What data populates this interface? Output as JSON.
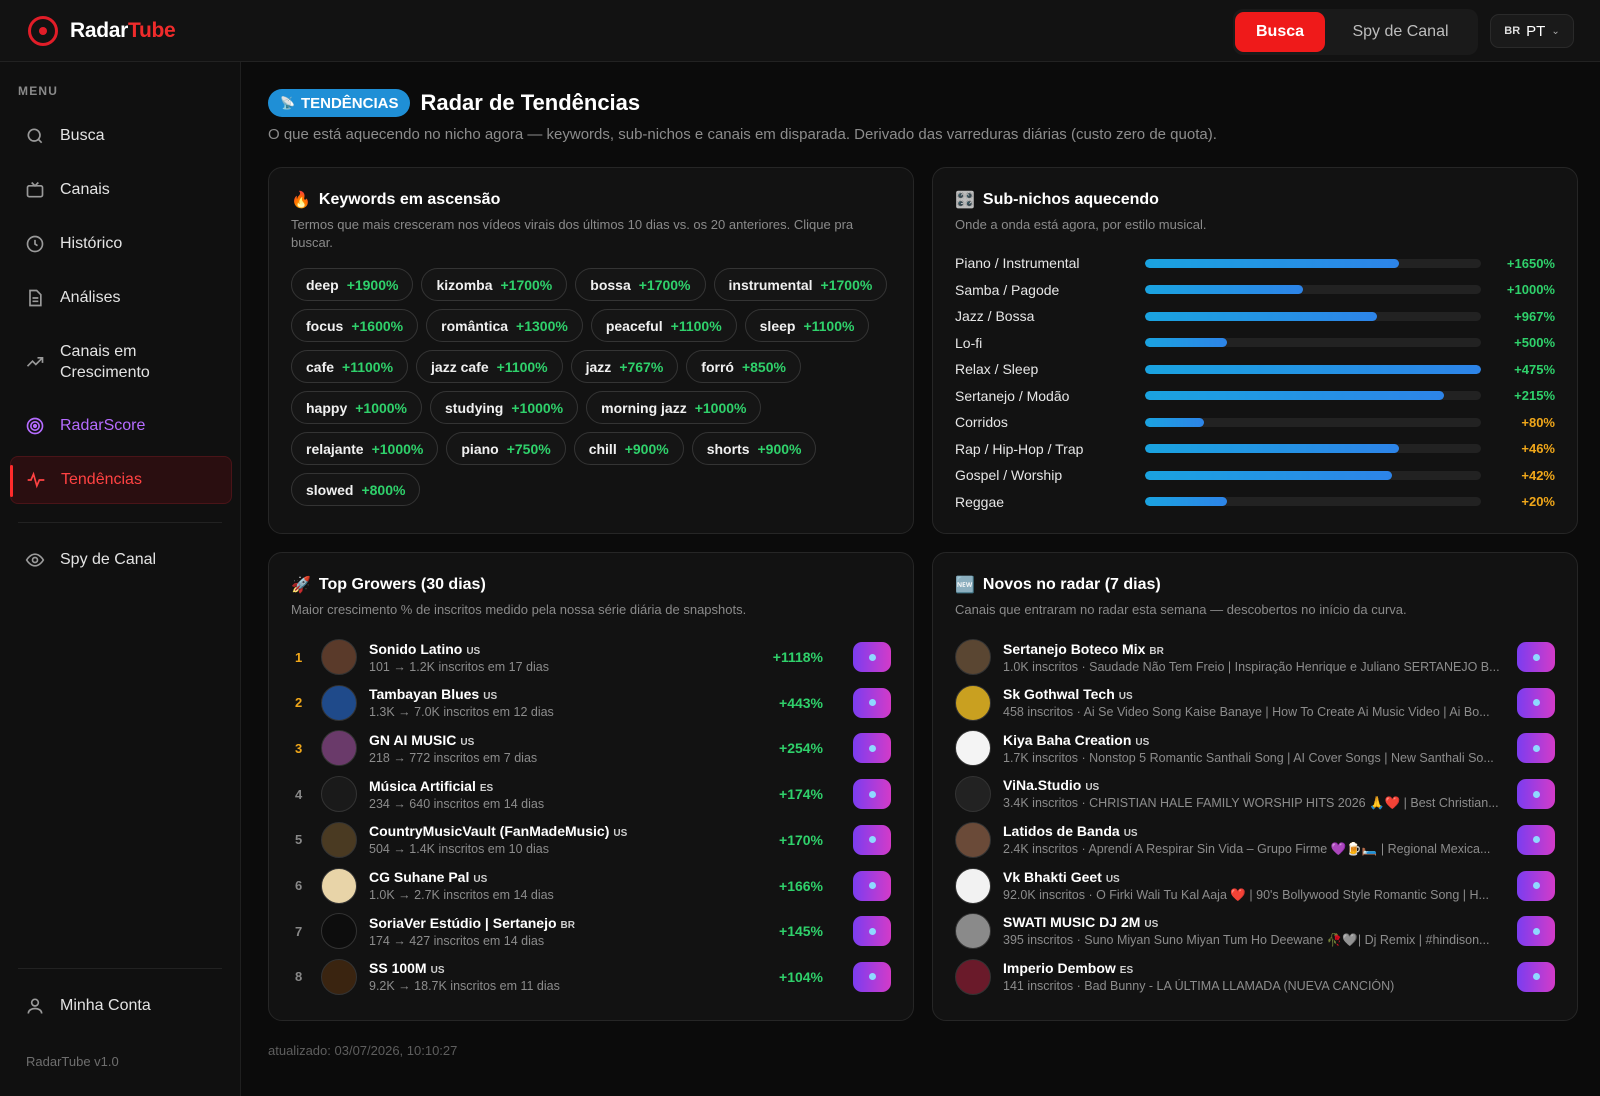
{
  "app": {
    "name_part1": "Radar",
    "name_part2": "Tube",
    "version": "RadarTube v1.0"
  },
  "topbar": {
    "busca": "Busca",
    "spy": "Spy de Canal",
    "lang_flag": "BR",
    "lang": "PT"
  },
  "sidebar": {
    "menu_label": "MENU",
    "items": [
      {
        "label": "Busca",
        "icon": "search-icon"
      },
      {
        "label": "Canais",
        "icon": "tv-icon"
      },
      {
        "label": "Histórico",
        "icon": "clock-icon"
      },
      {
        "label": "Análises",
        "icon": "document-icon"
      },
      {
        "label": "Canais em Crescimento",
        "icon": "trending-icon"
      },
      {
        "label": "RadarScore",
        "icon": "radar-icon"
      },
      {
        "label": "Tendências",
        "icon": "pulse-icon"
      },
      {
        "label": "Spy de Canal",
        "icon": "eye-icon"
      },
      {
        "label": "Minha Conta",
        "icon": "user-icon"
      }
    ]
  },
  "header": {
    "tag": "TENDÊNCIAS",
    "title": "Radar de Tendências",
    "subtitle": "O que está aquecendo no nicho agora — keywords, sub-nichos e canais em disparada. Derivado das varreduras diárias (custo zero de quota)."
  },
  "keywords": {
    "title": "Keywords em ascensão",
    "subtitle": "Termos que mais cresceram nos vídeos virais dos últimos 10 dias vs. os 20 anteriores. Clique pra buscar.",
    "items": [
      {
        "term": "deep",
        "pct": "+1900%"
      },
      {
        "term": "kizomba",
        "pct": "+1700%"
      },
      {
        "term": "bossa",
        "pct": "+1700%"
      },
      {
        "term": "instrumental",
        "pct": "+1700%"
      },
      {
        "term": "focus",
        "pct": "+1600%"
      },
      {
        "term": "romântica",
        "pct": "+1300%"
      },
      {
        "term": "peaceful",
        "pct": "+1100%"
      },
      {
        "term": "sleep",
        "pct": "+1100%"
      },
      {
        "term": "cafe",
        "pct": "+1100%"
      },
      {
        "term": "jazz cafe",
        "pct": "+1100%"
      },
      {
        "term": "jazz",
        "pct": "+767%"
      },
      {
        "term": "forró",
        "pct": "+850%"
      },
      {
        "term": "happy",
        "pct": "+1000%"
      },
      {
        "term": "studying",
        "pct": "+1000%"
      },
      {
        "term": "morning jazz",
        "pct": "+1000%"
      },
      {
        "term": "relajante",
        "pct": "+1000%"
      },
      {
        "term": "piano",
        "pct": "+750%"
      },
      {
        "term": "chill",
        "pct": "+900%"
      },
      {
        "term": "shorts",
        "pct": "+900%"
      },
      {
        "term": "slowed",
        "pct": "+800%"
      }
    ]
  },
  "subniches": {
    "title": "Sub-nichos aquecendo",
    "subtitle": "Onde a onda está agora, por estilo musical.",
    "items": [
      {
        "label": "Piano / Instrumental",
        "pct": "+1650%",
        "level": 0.755,
        "color": "#2fd16b"
      },
      {
        "label": "Samba / Pagode",
        "pct": "+1000%",
        "level": 0.47,
        "color": "#2fd16b"
      },
      {
        "label": "Jazz / Bossa",
        "pct": "+967%",
        "level": 0.69,
        "color": "#2fd16b"
      },
      {
        "label": "Lo-fi",
        "pct": "+500%",
        "level": 0.245,
        "color": "#2fd16b"
      },
      {
        "label": "Relax / Sleep",
        "pct": "+475%",
        "level": 1.0,
        "color": "#2fd16b"
      },
      {
        "label": "Sertanejo / Modão",
        "pct": "+215%",
        "level": 0.89,
        "color": "#2fd16b"
      },
      {
        "label": "Corridos",
        "pct": "+80%",
        "level": 0.175,
        "color": "#f0a71a"
      },
      {
        "label": "Rap / Hip-Hop / Trap",
        "pct": "+46%",
        "level": 0.755,
        "color": "#f0a71a"
      },
      {
        "label": "Gospel / Worship",
        "pct": "+42%",
        "level": 0.735,
        "color": "#f0a71a"
      },
      {
        "label": "Reggae",
        "pct": "+20%",
        "level": 0.245,
        "color": "#f0a71a"
      }
    ]
  },
  "growers": {
    "title": "Top Growers (30 dias)",
    "subtitle": "Maior crescimento % de inscritos medido pela nossa série diária de snapshots.",
    "items": [
      {
        "rank": "1",
        "name": "Sonido Latino",
        "cc": "US",
        "meta": "101 → 1.2K inscritos em 17 dias",
        "growth": "+1118%",
        "avatar_color": "#5a3a2a"
      },
      {
        "rank": "2",
        "name": "Tambayan Blues",
        "cc": "US",
        "meta": "1.3K → 7.0K inscritos em 12 dias",
        "growth": "+443%",
        "avatar_color": "#1f4a8a"
      },
      {
        "rank": "3",
        "name": "GN AI MUSIC",
        "cc": "US",
        "meta": "218 → 772 inscritos em 7 dias",
        "growth": "+254%",
        "avatar_color": "#6a3a6a"
      },
      {
        "rank": "4",
        "name": "Música Artificial",
        "cc": "ES",
        "meta": "234 → 640 inscritos em 14 dias",
        "growth": "+174%",
        "avatar_color": "#1a1a1a"
      },
      {
        "rank": "5",
        "name": "CountryMusicVault (FanMadeMusic)",
        "cc": "US",
        "meta": "504 → 1.4K inscritos em 10 dias",
        "growth": "+170%",
        "avatar_color": "#4a3a22"
      },
      {
        "rank": "6",
        "name": "CG Suhane Pal",
        "cc": "US",
        "meta": "1.0K → 2.7K inscritos em 14 dias",
        "growth": "+166%",
        "avatar_color": "#e8d4a8"
      },
      {
        "rank": "7",
        "name": "SoriaVer Estúdio | Sertanejo",
        "cc": "BR",
        "meta": "174 → 427 inscritos em 14 dias",
        "growth": "+145%",
        "avatar_color": "#0d0d0d"
      },
      {
        "rank": "8",
        "name": "SS 100M",
        "cc": "US",
        "meta": "9.2K → 18.7K inscritos em 11 dias",
        "growth": "+104%",
        "avatar_color": "#3a2410"
      }
    ]
  },
  "novos": {
    "title": "Novos no radar (7 dias)",
    "subtitle": "Canais que entraram no radar esta semana — descobertos no início da curva.",
    "items": [
      {
        "name": "Sertanejo Boteco Mix",
        "cc": "BR",
        "meta": "1.0K inscritos · Saudade Não Tem Freio | Inspiração Henrique e Juliano SERTANEJO B...",
        "avatar_color": "#5a4632"
      },
      {
        "name": "Sk Gothwal Tech",
        "cc": "US",
        "meta": "458 inscritos · Ai Se Video Song Kaise Banaye | How To Create Ai Music Video | Ai Bo...",
        "avatar_color": "#c9a020"
      },
      {
        "name": "Kiya Baha Creation",
        "cc": "US",
        "meta": "1.7K inscritos · Nonstop 5 Romantic Santhali Song | AI Cover Songs | New Santhali So...",
        "avatar_color": "#f4f4f4"
      },
      {
        "name": "ViNa.Studio",
        "cc": "US",
        "meta": "3.4K inscritos · CHRISTIAN HALE FAMILY WORSHIP HITS 2026 🙏❤️ | Best Christian...",
        "avatar_color": "#222222"
      },
      {
        "name": "Latidos de Banda",
        "cc": "US",
        "meta": "2.4K inscritos · Aprendí A Respirar Sin Vida – Grupo Firme 💜🍺🛏️ | Regional Mexica...",
        "avatar_color": "#6a4a38"
      },
      {
        "name": "Vk Bhakti Geet",
        "cc": "US",
        "meta": "92.0K inscritos · O Firki Wali Tu Kal Aaja ❤️ | 90's Bollywood Style Romantic Song | H...",
        "avatar_color": "#f2f2f2"
      },
      {
        "name": "SWATI MUSIC DJ 2M",
        "cc": "US",
        "meta": "395 inscritos · Suno Miyan Suno Miyan Tum Ho Deewane 🥀🩶| Dj Remix | #hindison...",
        "avatar_color": "#8a8a8a"
      },
      {
        "name": "Imperio Dembow",
        "cc": "ES",
        "meta": "141 inscritos · Bad Bunny - LA ÚLTIMA LLAMADA (NUEVA CANCIÓN)",
        "avatar_color": "#6a1a2a"
      }
    ]
  },
  "updated": "atualizado: 03/07/2026, 10:10:27"
}
